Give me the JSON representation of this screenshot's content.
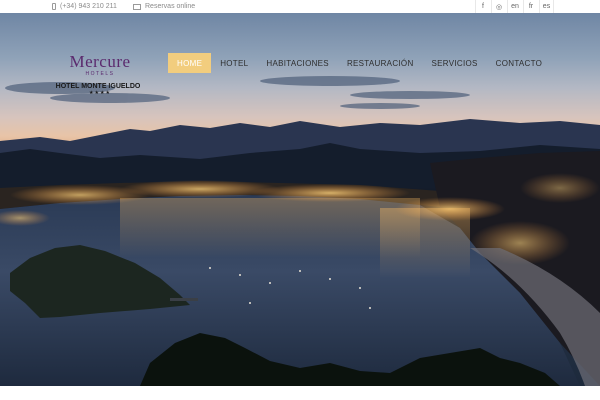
{
  "topbar": {
    "phone": "(+34) 943 210 211",
    "reservations": "Reservas online",
    "languages": [
      "f",
      "◎",
      "en",
      "fr",
      "es"
    ]
  },
  "logo": {
    "brand": "Mercure",
    "sub": "HOTELS",
    "name": "HOTEL MONTE IGUELDO",
    "stars": "★★★★"
  },
  "nav": {
    "items": [
      "HOME",
      "HOTEL",
      "HABITACIONES",
      "RESTAURACIÓN",
      "SERVICIOS",
      "CONTACTO"
    ],
    "active_index": 0
  },
  "colors": {
    "accent": "#f2cd7e",
    "brand_purple": "#5b2a6e",
    "city_lights": "#ffb84a"
  }
}
